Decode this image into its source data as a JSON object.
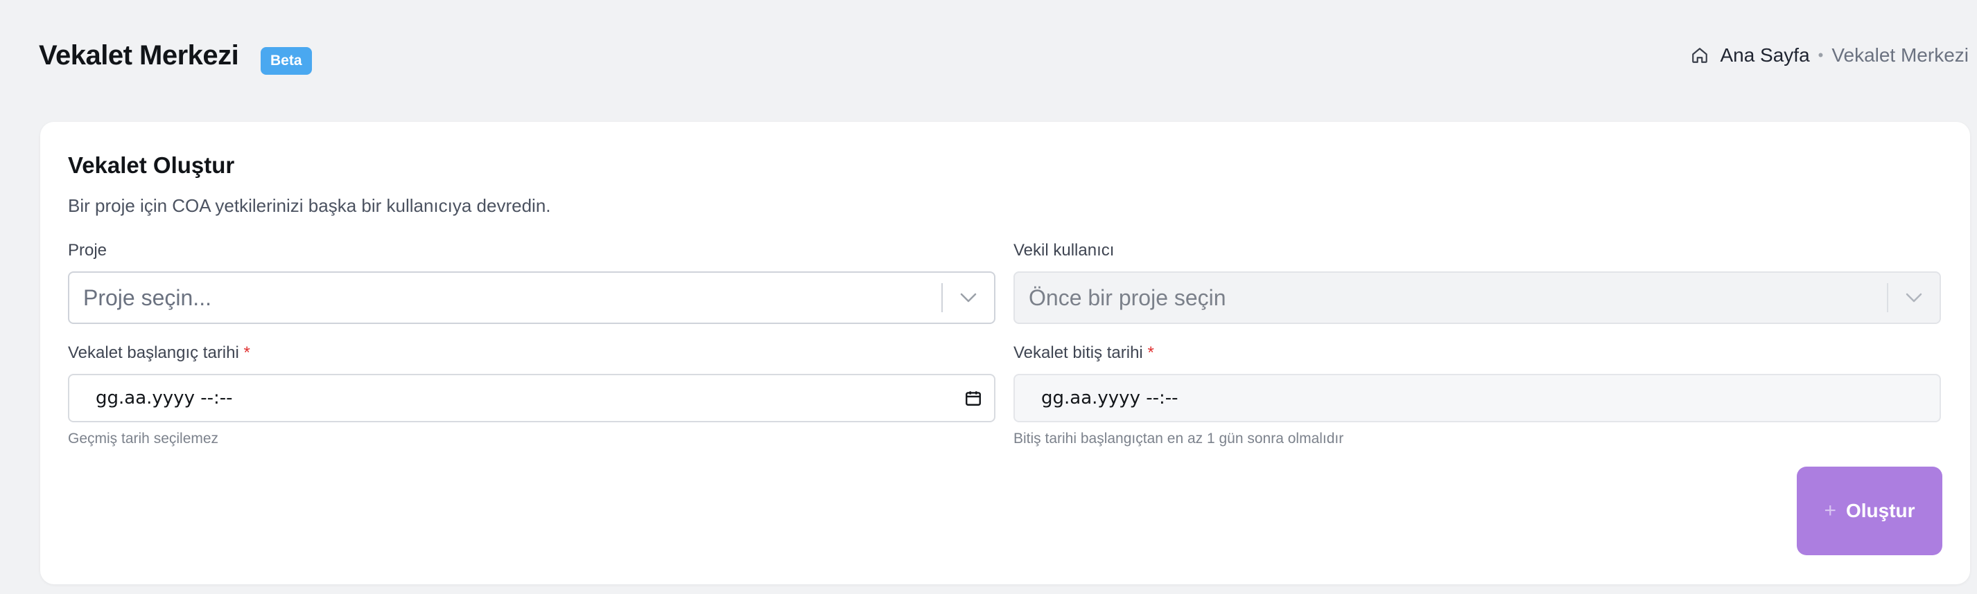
{
  "header": {
    "title": "Vekalet Merkezi",
    "badge": "Beta"
  },
  "breadcrumb": {
    "home_icon": "home-icon",
    "home_label": "Ana Sayfa",
    "separator": "•",
    "current": "Vekalet Merkezi"
  },
  "card": {
    "title": "Vekalet Oluştur",
    "description": "Bir proje için COA yetkilerinizi başka bir kullanıcıya devredin."
  },
  "form": {
    "project": {
      "label": "Proje",
      "placeholder": "Proje seçin..."
    },
    "delegate_user": {
      "label": "Vekil kullanıcı",
      "placeholder": "Önce bir proje seçin"
    },
    "start_date": {
      "label": "Vekalet başlangıç tarihi",
      "required_mark": "*",
      "value": "gg.aa.yyyy --:--",
      "hint": "Geçmiş tarih seçilemez"
    },
    "end_date": {
      "label": "Vekalet bitiş tarihi",
      "required_mark": "*",
      "value": "gg.aa.yyyy --:--",
      "hint": "Bitiş tarihi başlangıçtan en az 1 gün sonra olmalıdır"
    },
    "submit": {
      "icon": "plus-icon",
      "label": "Oluştur"
    }
  },
  "colors": {
    "badge": "#4aa8f0",
    "submit": "#ac7ee0",
    "required": "#e03131"
  }
}
